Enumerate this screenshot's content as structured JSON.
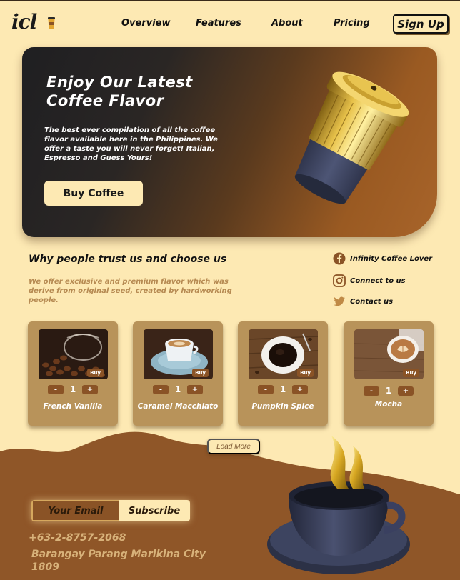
{
  "brand": {
    "logo_text": "icl"
  },
  "nav": {
    "links": [
      "Overview",
      "Features",
      "About",
      "Pricing"
    ],
    "signup_label": "Sign Up"
  },
  "hero": {
    "title": "Enjoy Our Latest Coffee Flavor",
    "body": "The best ever compilation of all the coffee flavor available here in the Philippines. We offer a taste you will never forget! Italian, Espresso and Guess Yours!",
    "cta_label": "Buy Coffee"
  },
  "trust": {
    "title": "Why people trust us and choose us",
    "body": "We offer exclusive and premium flavor which was derive from original seed, created by hardworking people."
  },
  "social": [
    {
      "icon": "facebook-icon",
      "label": "Infinity Coffee Lover"
    },
    {
      "icon": "instagram-icon",
      "label": "Connect to us"
    },
    {
      "icon": "twitter-icon",
      "label": "Contact us"
    }
  ],
  "products": [
    {
      "name": "French Vanilla",
      "qty": "1",
      "buy_label": "Buy",
      "minus": "-",
      "plus": "+"
    },
    {
      "name": "Caramel Macchiato",
      "qty": "1",
      "buy_label": "Buy",
      "minus": "-",
      "plus": "+"
    },
    {
      "name": "Pumpkin Spice",
      "qty": "1",
      "buy_label": "Buy",
      "minus": "-",
      "plus": "+"
    },
    {
      "name": "Mocha",
      "qty": "1",
      "buy_label": "Buy",
      "minus": "-",
      "plus": "+"
    }
  ],
  "load_more_label": "Load More",
  "footer": {
    "email_placeholder": "Your Email",
    "subscribe_label": "Subscribe",
    "phone": "+63-2-8757-2068",
    "address": "Barangay Parang Marikina City 1809"
  },
  "colors": {
    "background": "#fde9b3",
    "brown": "#8a5326",
    "card": "#b8935a",
    "hero_dark": "#1f1f22"
  }
}
